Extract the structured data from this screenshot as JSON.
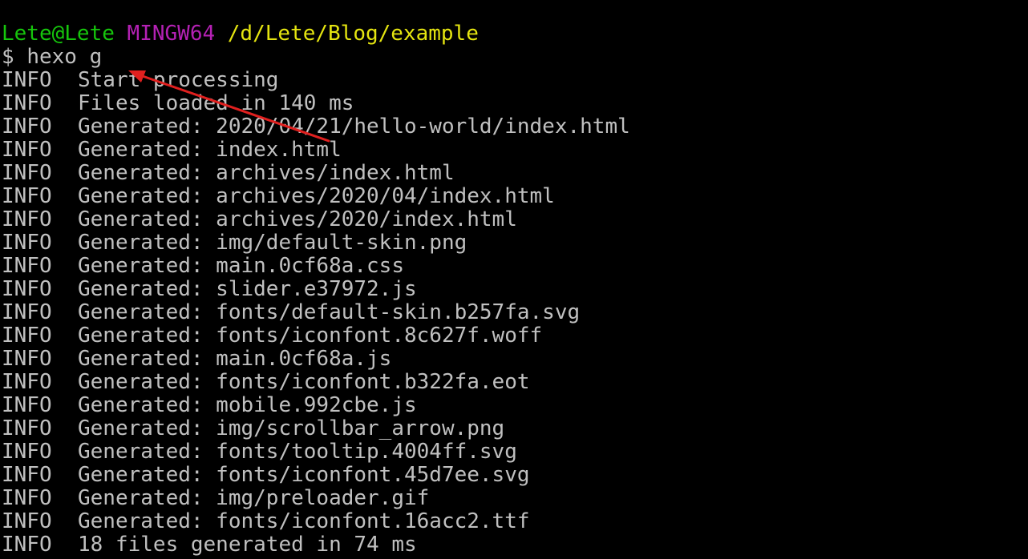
{
  "prompt_header": {
    "user_host": "Lete@Lete",
    "system": "MINGW64",
    "cwd": "/d/Lete/Blog/example"
  },
  "command": {
    "symbol": "$",
    "text": "hexo g"
  },
  "log": [
    {
      "level": "INFO",
      "message": "Start processing"
    },
    {
      "level": "INFO",
      "message": "Files loaded in 140 ms"
    },
    {
      "level": "INFO",
      "message": "Generated: 2020/04/21/hello-world/index.html"
    },
    {
      "level": "INFO",
      "message": "Generated: index.html"
    },
    {
      "level": "INFO",
      "message": "Generated: archives/index.html"
    },
    {
      "level": "INFO",
      "message": "Generated: archives/2020/04/index.html"
    },
    {
      "level": "INFO",
      "message": "Generated: archives/2020/index.html"
    },
    {
      "level": "INFO",
      "message": "Generated: img/default-skin.png"
    },
    {
      "level": "INFO",
      "message": "Generated: main.0cf68a.css"
    },
    {
      "level": "INFO",
      "message": "Generated: slider.e37972.js"
    },
    {
      "level": "INFO",
      "message": "Generated: fonts/default-skin.b257fa.svg"
    },
    {
      "level": "INFO",
      "message": "Generated: fonts/iconfont.8c627f.woff"
    },
    {
      "level": "INFO",
      "message": "Generated: main.0cf68a.js"
    },
    {
      "level": "INFO",
      "message": "Generated: fonts/iconfont.b322fa.eot"
    },
    {
      "level": "INFO",
      "message": "Generated: mobile.992cbe.js"
    },
    {
      "level": "INFO",
      "message": "Generated: img/scrollbar_arrow.png"
    },
    {
      "level": "INFO",
      "message": "Generated: fonts/tooltip.4004ff.svg"
    },
    {
      "level": "INFO",
      "message": "Generated: fonts/iconfont.45d7ee.svg"
    },
    {
      "level": "INFO",
      "message": "Generated: img/preloader.gif"
    },
    {
      "level": "INFO",
      "message": "Generated: fonts/iconfont.16acc2.ttf"
    },
    {
      "level": "INFO",
      "message": "18 files generated in 74 ms"
    }
  ],
  "colors": {
    "background": "#000000",
    "text": "#c0c0c0",
    "user_host": "#16c60c",
    "system": "#b421b4",
    "cwd": "#e5e510",
    "annotation_arrow": "#e0201f"
  },
  "annotation": {
    "icon": "arrow-icon"
  }
}
